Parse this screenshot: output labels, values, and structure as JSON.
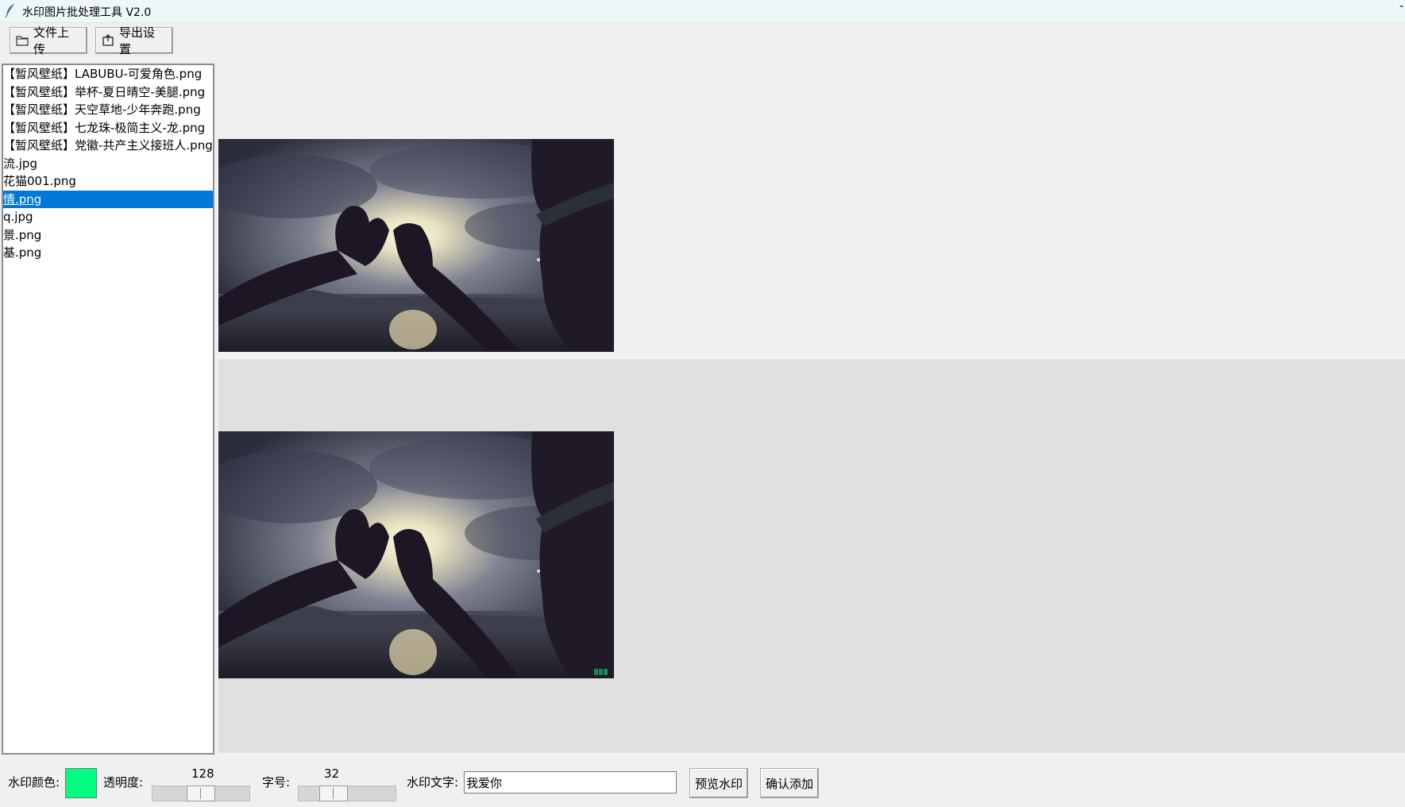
{
  "window": {
    "title": "水印图片批处理工具 V2.0",
    "minimize_glyph": "-"
  },
  "toolbar": {
    "upload_label": "文件上传",
    "upload_icon": "folder-icon",
    "export_label": "导出设置",
    "export_icon": "export-icon"
  },
  "file_list": {
    "items": [
      "【暂风壁纸】LABUBU-可爱角色.png",
      "【暂风壁纸】举杯-夏日晴空-美腿.png",
      "【暂风壁纸】天空草地-少年奔跑.png",
      "【暂风壁纸】七龙珠-极简主义-龙.png",
      "【暂风壁纸】党徽-共产主义接班人.png",
      "流.jpg",
      "花猫001.png",
      "情.png",
      "q.jpg",
      "景.png",
      "基.png"
    ],
    "selected_index": 7
  },
  "bottom": {
    "color_label": "水印颜色:",
    "color_value": "#00ff80",
    "opacity_label": "透明度:",
    "opacity_value": "128",
    "opacity_fraction": 0.5,
    "size_label": "字号:",
    "size_value": "32",
    "size_fraction": 0.3,
    "text_label": "水印文字:",
    "text_value": "我爱你",
    "preview_button": "预览水印",
    "confirm_button": "确认添加"
  }
}
